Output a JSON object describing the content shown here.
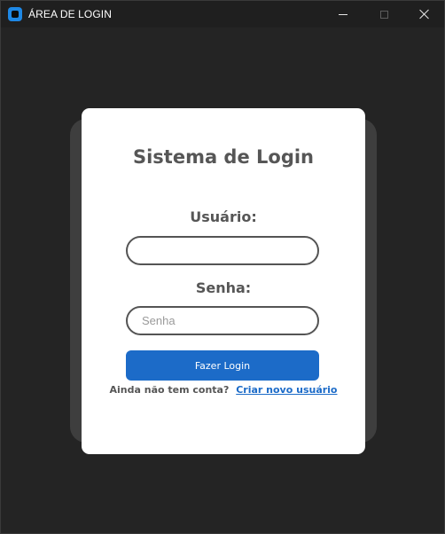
{
  "window": {
    "title": "ÁREA DE LOGIN",
    "icon": "app-icon",
    "accent_color": "#1e88e5"
  },
  "login": {
    "title": "Sistema de Login",
    "username_label": "Usuário:",
    "username_value": "",
    "password_label": "Senha:",
    "password_placeholder": "Senha",
    "login_button": "Fazer Login",
    "signup_prompt": "Ainda não tem conta?",
    "signup_link": "Criar novo usuário",
    "button_color": "#1c6bc8",
    "card_background": "#ffffff",
    "text_color": "#565656"
  }
}
